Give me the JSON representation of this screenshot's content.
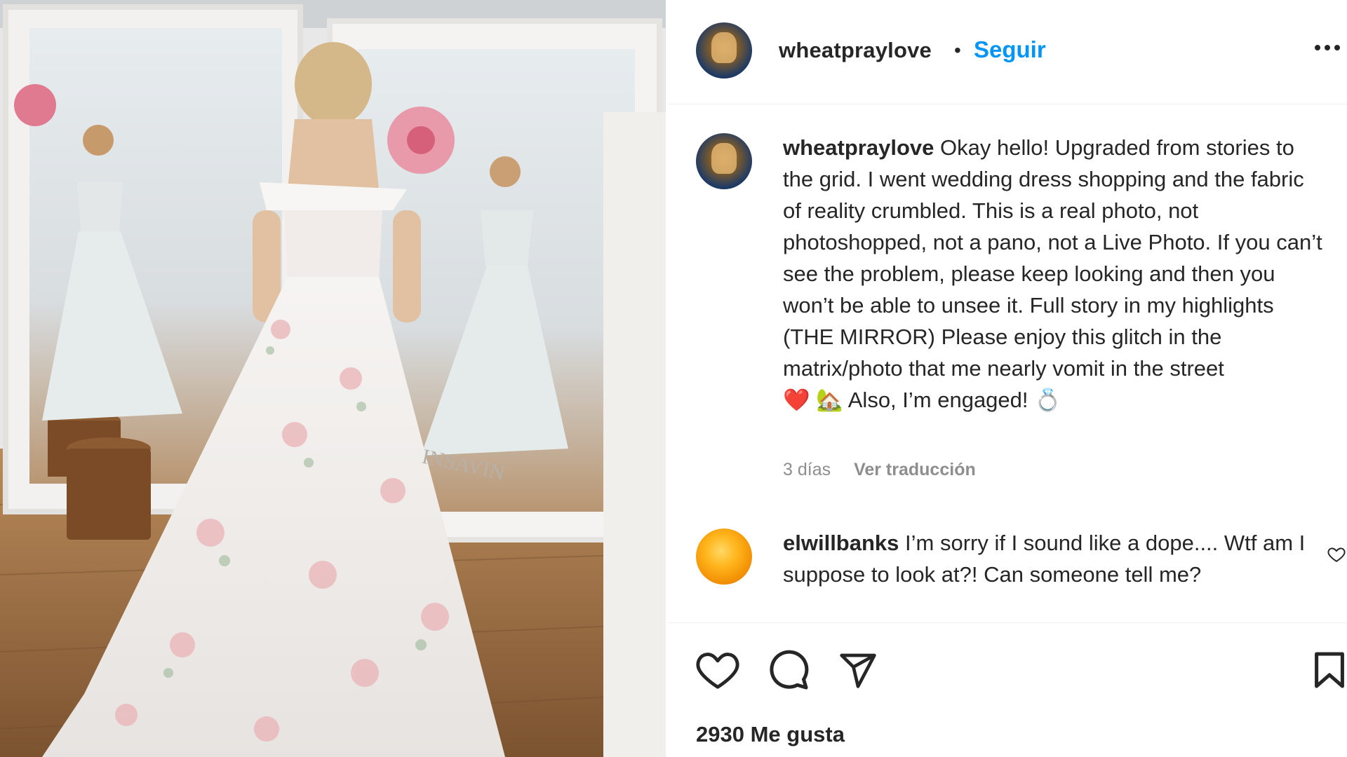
{
  "post": {
    "username": "wheatpraylove",
    "separator": "•",
    "follow_label": "Seguir",
    "more_icon": "more-horizontal-icon"
  },
  "caption": {
    "username": "wheatpraylove",
    "text": "Okay hello! Upgraded from stories to the grid. I went wedding dress shopping and the fabric of reality crumbled. This is a real photo, not photoshopped, not a pano, not a Live Photo. If you can’t see the problem, please keep looking and then you won’t be able to unsee it. Full story in my highlights (THE MIRROR) Please enjoy this glitch in the matrix/photo that me nearly vomit in the street",
    "emoji_1": "❤️",
    "emoji_2": "🏡",
    "text_2": "Also, I’m engaged!",
    "emoji_3": "💍",
    "time": "3 días",
    "translate_label": "Ver traducción"
  },
  "comment": {
    "username": "elwillbanks",
    "text": "I’m sorry if I sound like a dope.... Wtf am I suppose to look at?! Can someone tell me?"
  },
  "actions": {
    "like_icon": "heart-icon",
    "comment_icon": "comment-icon",
    "share_icon": "send-icon",
    "save_icon": "bookmark-icon"
  },
  "likes": "2930 Me gusta",
  "photo": {
    "watermark": "INSAVIN"
  },
  "colors": {
    "accent": "#0095f6",
    "text": "#262626",
    "muted": "#8e8e8e"
  }
}
